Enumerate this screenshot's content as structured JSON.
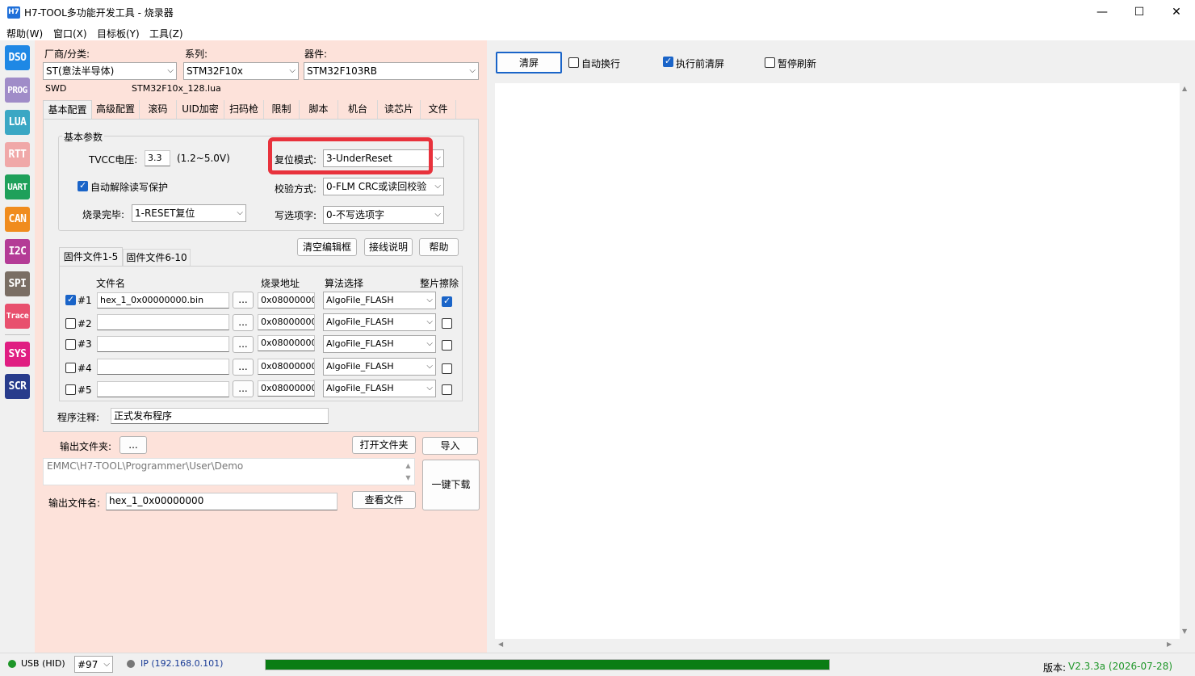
{
  "window": {
    "icon_text": "H7",
    "title": "H7-TOOL多功能开发工具 - 烧录器",
    "min_glyph": "—",
    "max_glyph": "☐",
    "close_glyph": "✕"
  },
  "menu": [
    "帮助(W)",
    "窗口(X)",
    "目标板(Y)",
    "工具(Z)"
  ],
  "tools": [
    {
      "label": "DSO",
      "color": "#1e88e5"
    },
    {
      "label": "PROG",
      "color": "#a08cc8"
    },
    {
      "label": "LUA",
      "color": "#3aa7c4"
    },
    {
      "label": "RTT",
      "color": "#f0a8a8"
    },
    {
      "label": "UART",
      "color": "#1ea05a"
    },
    {
      "label": "CAN",
      "color": "#f08c1e"
    },
    {
      "label": "I2C",
      "color": "#b43c96"
    },
    {
      "label": "SPI",
      "color": "#7a6e64"
    },
    {
      "label": "Trace",
      "color": "#e8506e"
    },
    {
      "label": "SYS",
      "color": "#e01e82"
    },
    {
      "label": "SCR",
      "color": "#283c8c"
    }
  ],
  "device": {
    "vendor_label": "厂商/分类:",
    "vendor_value": "ST(意法半导体)",
    "series_label": "系列:",
    "series_value": "STM32F10x",
    "part_label": "器件:",
    "part_value": "STM32F103RB",
    "interface": "SWD",
    "lua_file": "STM32F10x_128.lua"
  },
  "tabs": [
    "基本配置",
    "高级配置",
    "滚码",
    "UID加密",
    "扫码枪",
    "限制",
    "脚本",
    "机台",
    "读芯片",
    "文件"
  ],
  "basic": {
    "group_title": "基本参数",
    "tvcc_label": "TVCC电压:",
    "tvcc_value": "3.3",
    "tvcc_range": "(1.2~5.0V)",
    "auto_unlock_label": "自动解除读写保护",
    "auto_unlock_checked": true,
    "after_prog_label": "烧录完毕:",
    "after_prog_value": "1-RESET复位",
    "reset_mode_label": "复位模式:",
    "reset_mode_value": "3-UnderReset",
    "verify_label": "校验方式:",
    "verify_value": "0-FLM CRC或读回校验",
    "option_label": "写选项字:",
    "option_value": "0-不写选项字",
    "highlight_color": "#e8323c"
  },
  "buttons": {
    "clear_editor": "清空编辑框",
    "wiring": "接线说明",
    "help": "帮助"
  },
  "fw_tabs": [
    "固件文件1-5",
    "固件文件6-10"
  ],
  "fw_headers": {
    "filename": "文件名",
    "address": "烧录地址",
    "algo": "算法选择",
    "erase": "整片擦除"
  },
  "fw_rows": [
    {
      "label": "#1",
      "checked": true,
      "file": "hex_1_0x00000000.bin",
      "addr": "0x08000000",
      "algo": "AlgoFile_FLASH",
      "erase": true
    },
    {
      "label": "#2",
      "checked": false,
      "file": "",
      "addr": "0x08000000",
      "algo": "AlgoFile_FLASH",
      "erase": false
    },
    {
      "label": "#3",
      "checked": false,
      "file": "",
      "addr": "0x08000000",
      "algo": "AlgoFile_FLASH",
      "erase": false
    },
    {
      "label": "#4",
      "checked": false,
      "file": "",
      "addr": "0x08000000",
      "algo": "AlgoFile_FLASH",
      "erase": false
    },
    {
      "label": "#5",
      "checked": false,
      "file": "",
      "addr": "0x08000000",
      "algo": "AlgoFile_FLASH",
      "erase": false
    }
  ],
  "browse_label": "...",
  "comment": {
    "label": "程序注释:",
    "value": "正式发布程序"
  },
  "output": {
    "folder_label": "输出文件夹:",
    "folder_browse": "...",
    "open_folder": "打开文件夹",
    "import": "导入",
    "path": "EMMC\\H7-TOOL\\Programmer\\User\\Demo",
    "filename_label": "输出文件名:",
    "filename_value": "hex_1_0x00000000",
    "view_file": "查看文件",
    "one_key": "一键下载"
  },
  "right": {
    "clear": "清屏",
    "auto_wrap": "自动换行",
    "auto_wrap_checked": false,
    "clear_before": "执行前清屏",
    "clear_before_checked": true,
    "pause_refresh": "暂停刷新",
    "pause_refresh_checked": false
  },
  "status": {
    "usb": "USB (HID)",
    "usb_color": "#1e9628",
    "port": "#97",
    "ip": "IP (192.168.0.101)",
    "ip_color": "#777777",
    "progress": 1.0,
    "progress_color": "#0a7d14",
    "version_label": "版本:",
    "version_value": "V2.3.3a (2026-07-28)",
    "version_color": "#1e9628"
  }
}
